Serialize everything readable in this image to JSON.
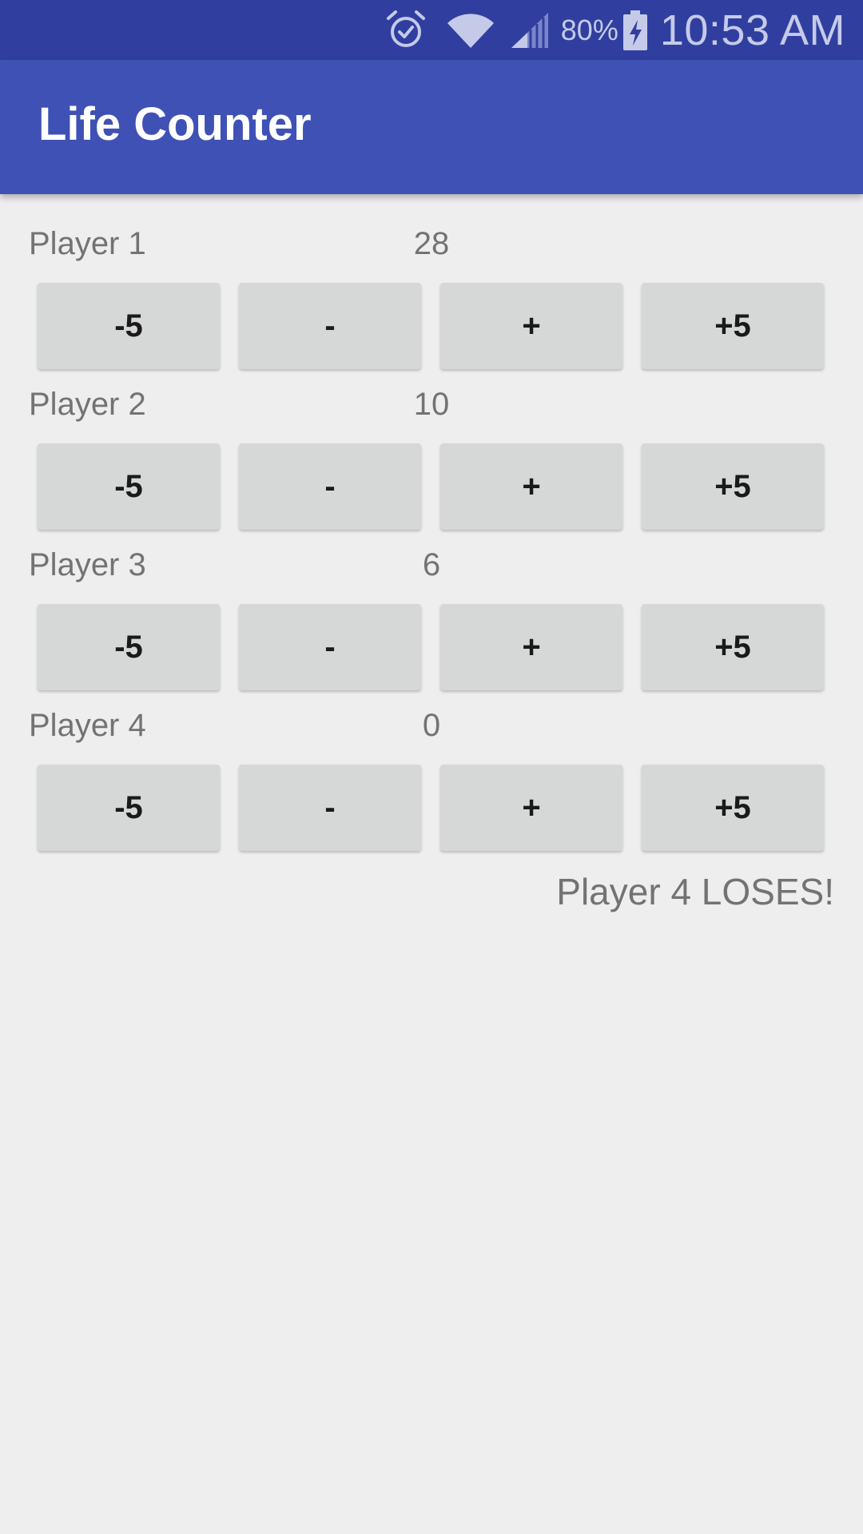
{
  "status_bar": {
    "battery_percent": "80%",
    "time": "10:53 AM",
    "icons": [
      "alarm-icon",
      "wifi-icon",
      "cell-signal-icon",
      "battery-charging-icon"
    ]
  },
  "app_bar": {
    "title": "Life Counter",
    "color": "#3f51b5"
  },
  "players": [
    {
      "name": "Player 1",
      "life": "28",
      "buttons": [
        "-5",
        "-",
        "+",
        "+5"
      ]
    },
    {
      "name": "Player 2",
      "life": "10",
      "buttons": [
        "-5",
        "-",
        "+",
        "+5"
      ]
    },
    {
      "name": "Player 3",
      "life": "6",
      "buttons": [
        "-5",
        "-",
        "+",
        "+5"
      ]
    },
    {
      "name": "Player 4",
      "life": "0",
      "buttons": [
        "-5",
        "-",
        "+",
        "+5"
      ]
    }
  ],
  "result": "Player 4 LOSES!"
}
